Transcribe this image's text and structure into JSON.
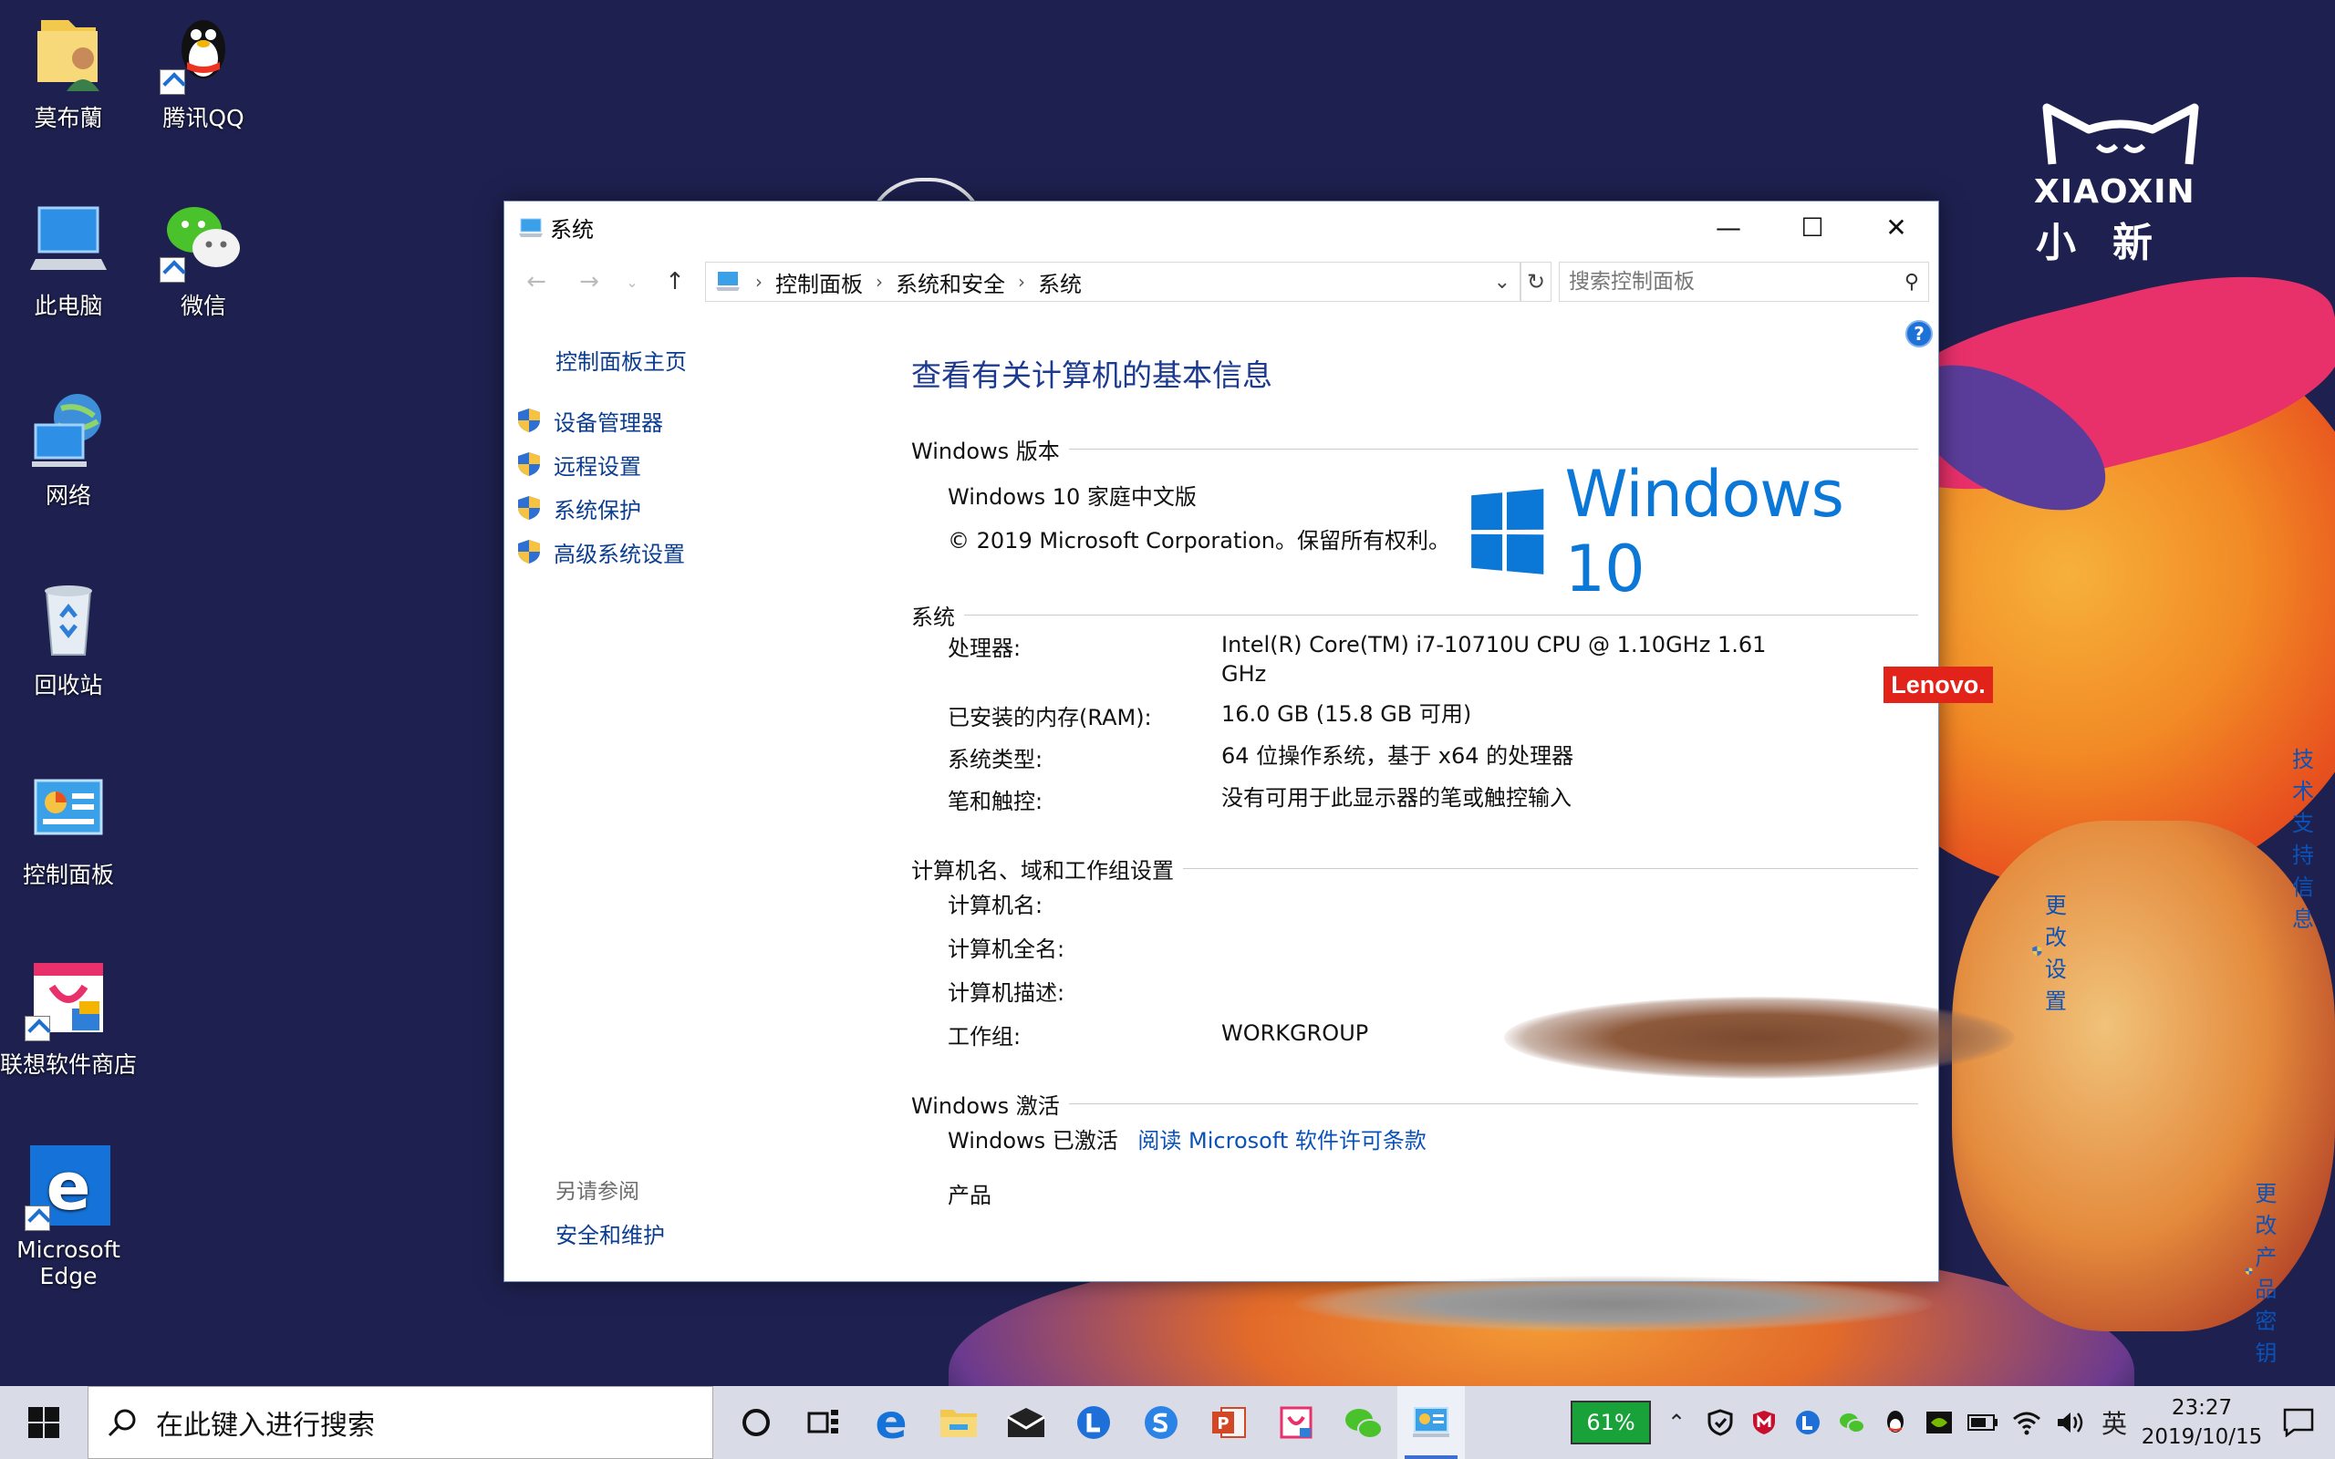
{
  "desktop": {
    "icons": [
      {
        "label": "莫布蘭"
      },
      {
        "label": "腾讯QQ"
      },
      {
        "label": "此电脑"
      },
      {
        "label": "微信"
      },
      {
        "label": "网络"
      },
      {
        "label": "回收站"
      },
      {
        "label": "控制面板"
      },
      {
        "label": "联想软件商店"
      },
      {
        "label": "Microsoft Edge"
      }
    ],
    "brand": {
      "line1": "XIAOXIN",
      "line2": "小新"
    }
  },
  "window": {
    "title": "系统",
    "breadcrumb": [
      "控制面板",
      "系统和安全",
      "系统"
    ],
    "search_placeholder": "搜索控制面板",
    "help_label": "?",
    "left": {
      "home": "控制面板主页",
      "items": [
        "设备管理器",
        "远程设置",
        "系统保护",
        "高级系统设置"
      ],
      "see_also": "另请参阅",
      "see_also_items": [
        "安全和维护"
      ]
    },
    "main": {
      "heading": "查看有关计算机的基本信息",
      "edition": {
        "section": "Windows 版本",
        "name": "Windows 10 家庭中文版",
        "copyright": "© 2019 Microsoft Corporation。保留所有权利。",
        "logo_text": "Windows 10"
      },
      "system": {
        "section": "系统",
        "oem": "Lenovo.",
        "support_link": "技术支持信息",
        "rows": [
          {
            "label": "处理器:",
            "value": "Intel(R) Core(TM) i7-10710U CPU @ 1.10GHz   1.61 GHz"
          },
          {
            "label": "已安装的内存(RAM):",
            "value": "16.0 GB (15.8 GB 可用)"
          },
          {
            "label": "系统类型:",
            "value": "64 位操作系统，基于 x64 的处理器"
          },
          {
            "label": "笔和触控:",
            "value": "没有可用于此显示器的笔或触控输入"
          }
        ]
      },
      "computer": {
        "section": "计算机名、域和工作组设置",
        "change_link": "更改设置",
        "rows": [
          {
            "label": "计算机名:",
            "value": ""
          },
          {
            "label": "计算机全名:",
            "value": ""
          },
          {
            "label": "计算机描述:",
            "value": ""
          },
          {
            "label": "工作组:",
            "value": "WORKGROUP"
          }
        ]
      },
      "activation": {
        "section": "Windows 激活",
        "status": "Windows 已激活",
        "license_link": "阅读 Microsoft 软件许可条款",
        "product_label": "产品",
        "change_key": "更改产品密钥"
      }
    }
  },
  "taskbar": {
    "search_placeholder": "在此键入进行搜索",
    "battery": "61%",
    "ime": "英",
    "time": "23:27",
    "date": "2019/10/15"
  },
  "colors": {
    "accent": "#0b77d7",
    "link": "#0b3d91",
    "lenovo": "#e2231a"
  }
}
